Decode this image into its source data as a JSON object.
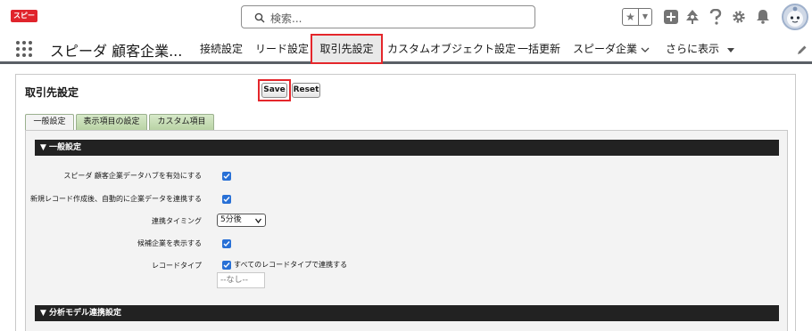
{
  "header": {
    "logo_text": "スピーダ",
    "search_placeholder": "検索..."
  },
  "nav": {
    "app_name": "スピーダ 顧客企業...",
    "tabs": [
      {
        "label": "接続設定"
      },
      {
        "label": "リード設定"
      },
      {
        "label": "取引先設定",
        "active": true
      },
      {
        "label": "カスタムオブジェクト設定"
      },
      {
        "label": "一括更新"
      },
      {
        "label": "スピーダ企業",
        "has_dropdown": true
      },
      {
        "label": "さらに表示",
        "has_dropdown": true
      }
    ]
  },
  "panel": {
    "title": "取引先設定",
    "save_label": "Save",
    "reset_label": "Reset",
    "subtabs": [
      {
        "label": "一般設定",
        "active": true
      },
      {
        "label": "表示項目の設定"
      },
      {
        "label": "カスタム項目"
      }
    ],
    "section_general": "▼ 一般設定",
    "section_model": "▼ 分析モデル連携設定",
    "fields": {
      "enable_hub_label": "スピーダ 顧客企業データハブを有効にする",
      "enable_hub_checked": true,
      "auto_link_label": "新規レコード作成後、自動的に企業データを連携する",
      "auto_link_checked": true,
      "timing_label": "連携タイミング",
      "timing_value": "5分後",
      "show_candidates_label": "候補企業を表示する",
      "show_candidates_checked": true,
      "record_type_label": "レコードタイプ",
      "record_type_all_label": "すべてのレコードタイプで連携する",
      "record_type_all_checked": true,
      "record_type_none": "--なし--"
    }
  },
  "colors": {
    "highlight": "#e4262b",
    "checkbox": "#2870d6",
    "section_bar": "#222222",
    "subtab_green": "#c6dcb6"
  }
}
